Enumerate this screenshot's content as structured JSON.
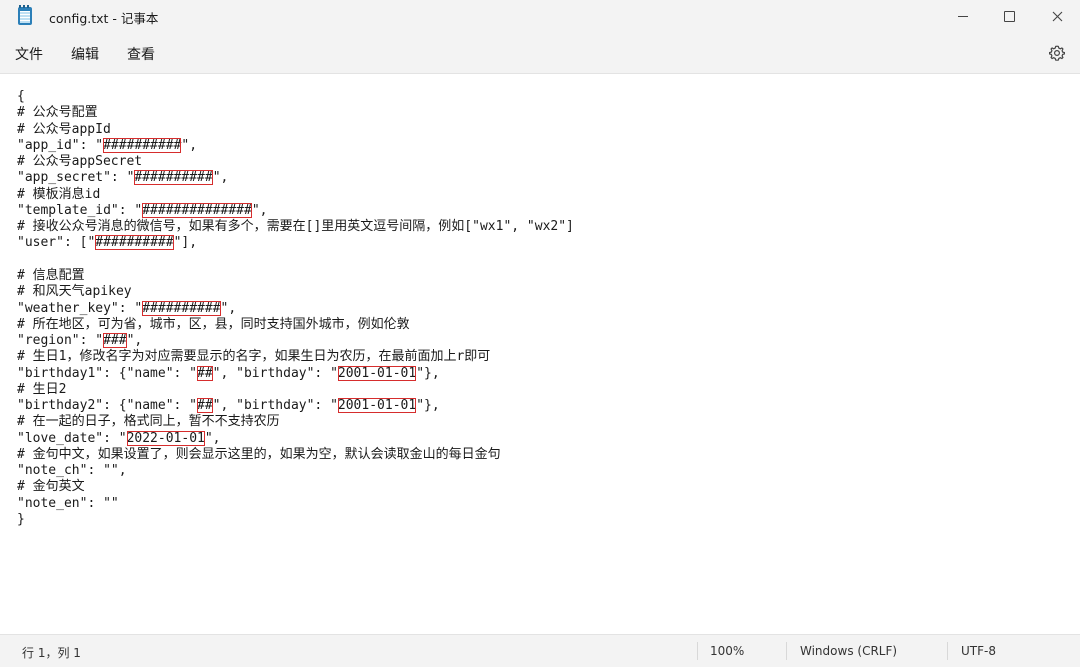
{
  "window": {
    "title": "config.txt - 记事本",
    "icon": "notepad-icon",
    "controls": {
      "minimize": "minimize-icon",
      "maximize": "maximize-icon",
      "close": "close-icon"
    }
  },
  "menu": {
    "file": "文件",
    "edit": "编辑",
    "view": "查看",
    "settings_icon": "gear-icon"
  },
  "editor": {
    "lines": [
      [
        {
          "t": "{"
        }
      ],
      [
        {
          "t": "# 公众号配置"
        }
      ],
      [
        {
          "t": "# 公众号appId"
        }
      ],
      [
        {
          "t": "\"app_id\": \""
        },
        {
          "t": "##########",
          "mark": true
        },
        {
          "t": "\","
        }
      ],
      [
        {
          "t": "# 公众号appSecret"
        }
      ],
      [
        {
          "t": "\"app_secret\": \""
        },
        {
          "t": "##########",
          "mark": true
        },
        {
          "t": "\","
        }
      ],
      [
        {
          "t": "# 模板消息id"
        }
      ],
      [
        {
          "t": "\"template_id\": \""
        },
        {
          "t": "##############",
          "mark": true
        },
        {
          "t": "\","
        }
      ],
      [
        {
          "t": "# 接收公众号消息的微信号，如果有多个，需要在[]里用英文逗号间隔，例如[\"wx1\", \"wx2\"]"
        }
      ],
      [
        {
          "t": "\"user\": [\""
        },
        {
          "t": "##########",
          "mark": true
        },
        {
          "t": "\"],"
        }
      ],
      [
        {
          "t": ""
        }
      ],
      [
        {
          "t": "# 信息配置"
        }
      ],
      [
        {
          "t": "# 和风天气apikey"
        }
      ],
      [
        {
          "t": "\"weather_key\": \""
        },
        {
          "t": "##########",
          "mark": true
        },
        {
          "t": "\","
        }
      ],
      [
        {
          "t": "# 所在地区，可为省，城市，区，县，同时支持国外城市，例如伦敦"
        }
      ],
      [
        {
          "t": "\"region\": \""
        },
        {
          "t": "###",
          "mark": true
        },
        {
          "t": "\","
        }
      ],
      [
        {
          "t": "# 生日1，修改名字为对应需要显示的名字，如果生日为农历，在最前面加上r即可"
        }
      ],
      [
        {
          "t": "\"birthday1\": {\"name\": \""
        },
        {
          "t": "##",
          "mark": true
        },
        {
          "t": "\", \"birthday\": \""
        },
        {
          "t": "2001-01-01",
          "mark": true
        },
        {
          "t": "\"},"
        }
      ],
      [
        {
          "t": "# 生日2"
        }
      ],
      [
        {
          "t": "\"birthday2\": {\"name\": \""
        },
        {
          "t": "##",
          "mark": true
        },
        {
          "t": "\", \"birthday\": \""
        },
        {
          "t": "2001-01-01",
          "mark": true
        },
        {
          "t": "\"},"
        }
      ],
      [
        {
          "t": "# 在一起的日子，格式同上，暂不不支持农历"
        }
      ],
      [
        {
          "t": "\"love_date\": \""
        },
        {
          "t": "2022-01-01",
          "mark": true
        },
        {
          "t": "\","
        }
      ],
      [
        {
          "t": "# 金句中文，如果设置了，则会显示这里的，如果为空，默认会读取金山的每日金句"
        }
      ],
      [
        {
          "t": "\"note_ch\": \"\","
        }
      ],
      [
        {
          "t": "# 金句英文"
        }
      ],
      [
        {
          "t": "\"note_en\": \"\""
        }
      ],
      [
        {
          "t": "}"
        }
      ]
    ]
  },
  "status": {
    "position": "行 1，列 1",
    "zoom": "100%",
    "line_ending": "Windows (CRLF)",
    "encoding": "UTF-8"
  },
  "colors": {
    "chrome": "#f3f3f3",
    "highlight_box": "#d62d2d"
  }
}
